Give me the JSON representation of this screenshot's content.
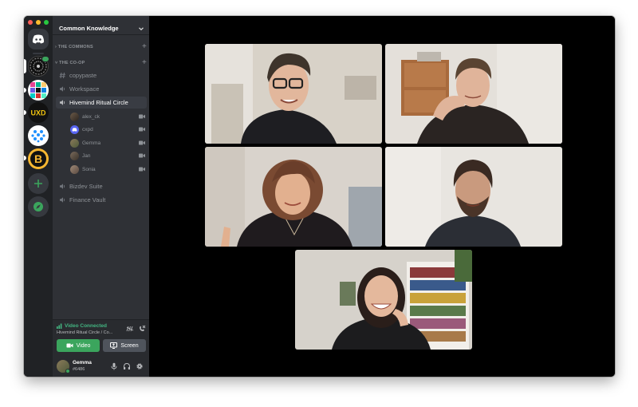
{
  "server_rail": {
    "servers": [
      {
        "name": "Discord Home",
        "icon": "discord-logo-icon"
      },
      {
        "name": "Common Knowledge",
        "icon": "common-knowledge-icon",
        "selected": true,
        "has_activity": true
      },
      {
        "name": "DAO server",
        "icon": "dao-mosaic-icon"
      },
      {
        "name": "UXD",
        "label": "UXD"
      },
      {
        "name": "Dots server",
        "icon": "dots-pattern-icon"
      },
      {
        "name": "B server",
        "label": "B"
      }
    ]
  },
  "guild": {
    "name": "Common Knowledge",
    "categories": [
      {
        "label": "THE COMMONS"
      },
      {
        "label": "THE CO-OP"
      }
    ],
    "channels": [
      {
        "label": "copypaste",
        "type": "text"
      },
      {
        "label": "Workspace",
        "type": "voice"
      },
      {
        "label": "Hivemind Ritual Circle",
        "type": "voice",
        "active": true
      },
      {
        "label": "Bizdev Suite",
        "type": "voice"
      },
      {
        "label": "Finance Vault",
        "type": "voice"
      }
    ],
    "voice_members": [
      {
        "name": "alex_ck"
      },
      {
        "name": "cxpd"
      },
      {
        "name": "Gemma"
      },
      {
        "name": "Jan"
      },
      {
        "name": "Sonia"
      }
    ]
  },
  "voice_panel": {
    "status": "Video Connected",
    "location": "Hivemind Ritual Circle / Co...",
    "video_label": "Video",
    "screen_label": "Screen"
  },
  "user": {
    "name": "Gemma",
    "tag": "#6486"
  },
  "colors": {
    "green": "#3ba55d",
    "sidebar": "#2f3136",
    "rail": "#202225",
    "blurple": "#5865f2"
  }
}
